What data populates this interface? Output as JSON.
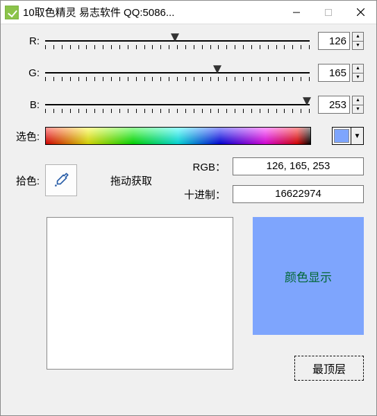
{
  "window": {
    "title": "10取色精灵 易志软件 QQ:5086..."
  },
  "labels": {
    "r": "R:",
    "g": "G:",
    "b": "B:",
    "select_color": "选色:",
    "pick_color": "拾色:",
    "drag_hint": "拖动获取",
    "rgb": "RGB：",
    "decimal": "十进制：",
    "color_display": "颜色显示",
    "topmost": "最顶层"
  },
  "values": {
    "r": "126",
    "g": "165",
    "b": "253",
    "rgb_tuple": "126, 165, 253",
    "decimal": "16622974"
  },
  "colors": {
    "current": "#7ea5fd"
  },
  "slider_thumbs": {
    "r_pct": 49,
    "g_pct": 65,
    "b_pct": 99
  }
}
